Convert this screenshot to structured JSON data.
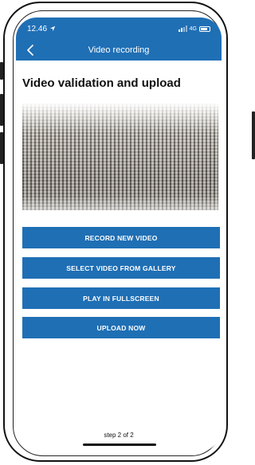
{
  "status_bar": {
    "time": "12.46",
    "network": "4G"
  },
  "nav": {
    "title": "Video recording",
    "back_icon": "chevron-left-icon"
  },
  "page": {
    "title": "Video validation and upload"
  },
  "hero_image": {
    "subject": "carpet-texture"
  },
  "buttons": [
    {
      "label": "RECORD NEW VIDEO"
    },
    {
      "label": "SELECT VIDEO FROM GALLERY"
    },
    {
      "label": "PLAY IN FULLSCREEN"
    },
    {
      "label": "UPLOAD NOW"
    }
  ],
  "footer": {
    "step": "step 2 of 2"
  },
  "colors": {
    "primary": "#1f6fb5",
    "text": "#111111",
    "background": "#ffffff"
  }
}
